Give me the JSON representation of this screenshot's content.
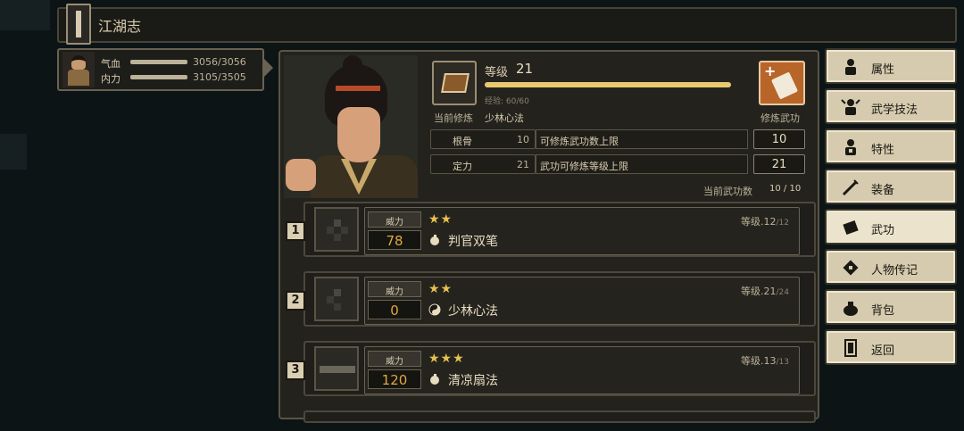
{
  "title": "江湖志",
  "status": {
    "hp_label": "气血",
    "hp_value": "3056/3056",
    "hp_ratio": 1.0,
    "mp_label": "内力",
    "mp_value": "3105/3505",
    "mp_ratio": 0.886
  },
  "info": {
    "level_label": "等级",
    "level": "21",
    "exp_text": "经验: 60/60",
    "exp_ratio": 1.0,
    "current_method_label": "当前修炼",
    "current_method": "少林心法",
    "train_label": "修炼武功",
    "attributes": [
      {
        "name": "根骨",
        "value": "10",
        "desc": "可修炼武功数上限",
        "cap": "10"
      },
      {
        "name": "定力",
        "value": "21",
        "desc": "武功可修炼等级上限",
        "cap": "21"
      }
    ],
    "count_label": "当前武功数",
    "count_value": "10 / 10"
  },
  "skills": [
    {
      "index": "1",
      "power_label": "威力",
      "power": "78",
      "stars": "★★",
      "level_label": "等级",
      "level": ".12",
      "max": "/12",
      "name": "判官双笔",
      "type_icon": "fist-icon"
    },
    {
      "index": "2",
      "power_label": "威力",
      "power": "0",
      "stars": "★★",
      "level_label": "等级",
      "level": ".21",
      "max": "/24",
      "name": "少林心法",
      "type_icon": "yinyang-icon"
    },
    {
      "index": "3",
      "power_label": "威力",
      "power": "120",
      "stars": "★★★",
      "level_label": "等级",
      "level": ".13",
      "max": "/13",
      "name": "清凉扇法",
      "type_icon": "fist-icon"
    }
  ],
  "menu": [
    {
      "label": "属性",
      "icon": "person-icon"
    },
    {
      "label": "武学技法",
      "icon": "martial-skill-icon"
    },
    {
      "label": "特性",
      "icon": "trait-icon"
    },
    {
      "label": "装备",
      "icon": "sword-icon"
    },
    {
      "label": "武功",
      "icon": "manual-icon",
      "active": true
    },
    {
      "label": "人物传记",
      "icon": "biography-icon"
    },
    {
      "label": "背包",
      "icon": "bag-icon"
    },
    {
      "label": "返回",
      "icon": "door-icon"
    }
  ],
  "colors": {
    "accent": "#e8c870",
    "power": "#e0a840",
    "menu_bg": "#d6cbaf"
  }
}
